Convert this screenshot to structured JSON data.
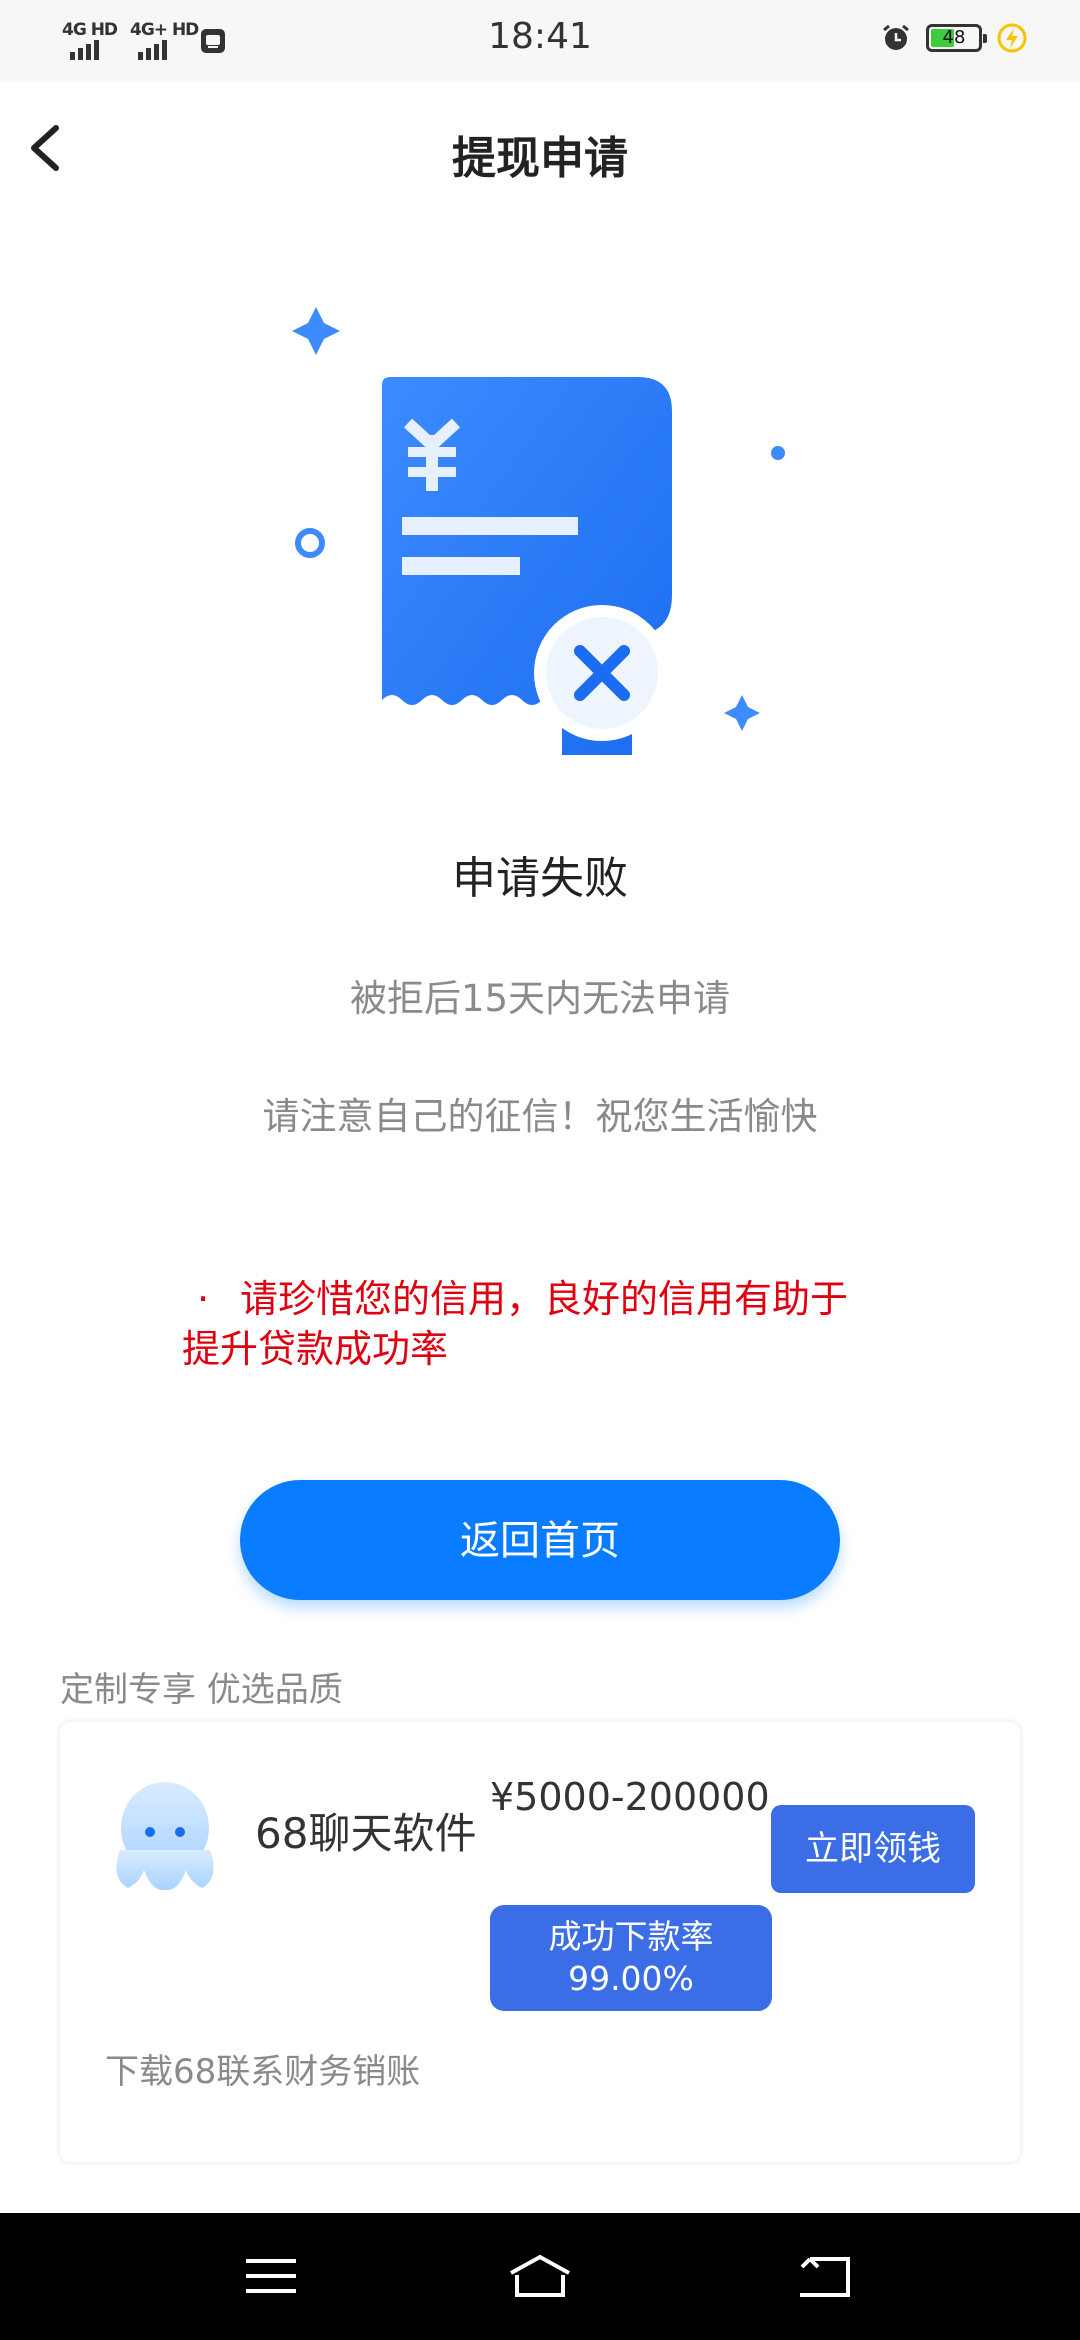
{
  "status_bar": {
    "network1": "4G HD",
    "network2": "4G+ HD",
    "time": "18:41",
    "battery_level": "48",
    "icons": [
      "signal-4g-icon",
      "signal-4g-plus-icon",
      "sim-card-icon",
      "alarm-icon",
      "battery-icon",
      "charging-icon"
    ]
  },
  "header": {
    "title": "提现申请",
    "back_icon": "chevron-left-icon"
  },
  "result": {
    "illustration": "receipt-failed-icon",
    "title": "申请失败",
    "line1": "被拒后15天内无法申请",
    "line2": "请注意自己的征信！祝您生活愉快"
  },
  "warning": {
    "bullet": "·",
    "text": "请珍惜您的信用，良好的信用有助于提升贷款成功率"
  },
  "home_button": {
    "label": "返回首页"
  },
  "recommend": {
    "section_title": "定制专享 优选品质",
    "card": {
      "avatar_icon": "octopus-mascot-icon",
      "name": "68聊天软件",
      "amount": "¥5000-200000",
      "claim_label": "立即领钱",
      "rate_label": "成功下款率",
      "rate_value": "99.00%",
      "tip": "下载68联系财务销账"
    }
  },
  "system_nav": {
    "icons": [
      "menu-icon",
      "home-icon",
      "back-icon"
    ]
  },
  "colors": {
    "primary": "#0a7cff",
    "card_button": "#3b6ee6",
    "warning": "#e0000f",
    "muted_text": "#8a8a8a",
    "status_bar_bg": "#f7f7f7",
    "battery_green": "#3dcc3d",
    "charging_yellow": "#f5c400"
  }
}
